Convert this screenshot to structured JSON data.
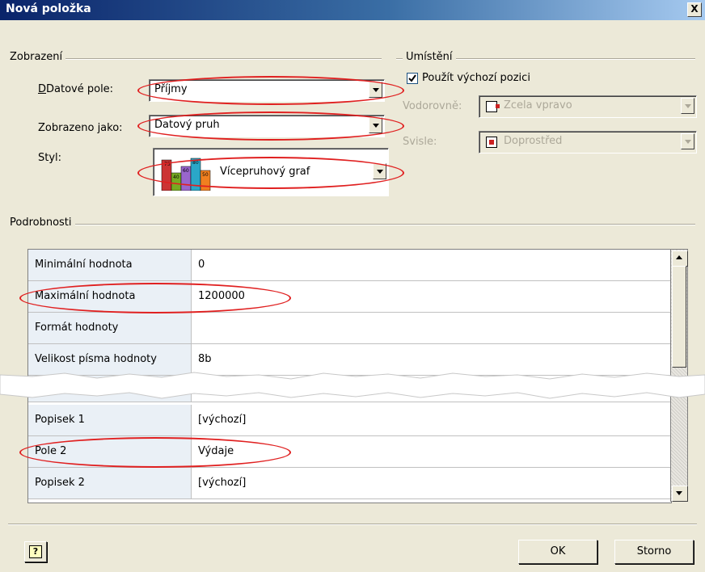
{
  "window": {
    "title": "Nová položka",
    "close_label": "X"
  },
  "display_group": {
    "label": "Zobrazení",
    "data_field_label": "Datové pole:",
    "data_field_value": "Příjmy",
    "shown_as_label": "Zobrazeno jako:",
    "shown_as_value": "Datový pruh",
    "style_label": "Styl:",
    "style_value": "Vícepruhový graf"
  },
  "placement_group": {
    "label": "Umístění",
    "use_default_label": "Použít výchozí pozici",
    "use_default_checked": true,
    "horizontal_label": "Vodorovně:",
    "horizontal_value": "Zcela vpravo",
    "vertical_label": "Svisle:",
    "vertical_value": "Doprostřed"
  },
  "details_group": {
    "label": "Podrobnosti",
    "rows_top": [
      {
        "key": "Minimální hodnota",
        "value": "0"
      },
      {
        "key": "Maximální hodnota",
        "value": "1200000"
      },
      {
        "key": "Formát hodnoty",
        "value": ""
      },
      {
        "key": "Velikost písma hodnoty",
        "value": "8b"
      }
    ],
    "rows_bottom": [
      {
        "key": "Popisek 1",
        "value": "[výchozí]"
      },
      {
        "key": "Pole 2",
        "value": "Výdaje"
      },
      {
        "key": "Popisek 2",
        "value": "[výchozí]"
      }
    ]
  },
  "style_icon_values": [
    "75",
    "40",
    "60",
    "80",
    "50"
  ],
  "buttons": {
    "ok": "OK",
    "cancel": "Storno",
    "help": "?"
  },
  "colors": {
    "title_start": "#0a246a",
    "title_end": "#a6caf0",
    "highlight_oval": "#e02020",
    "dialog_bg": "#ece9d8"
  }
}
